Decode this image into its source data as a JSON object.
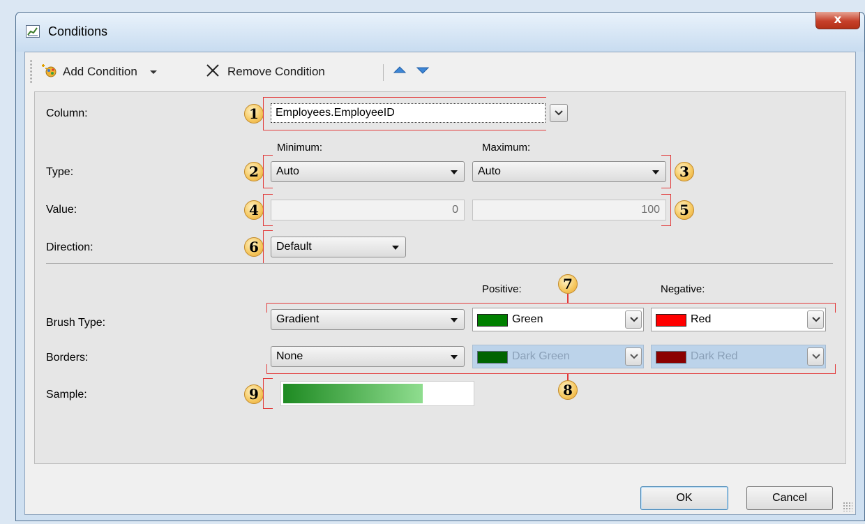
{
  "window": {
    "title": "Conditions",
    "close_label": "x"
  },
  "toolbar": {
    "add_label": "Add Condition",
    "remove_label": "Remove Condition"
  },
  "form": {
    "column_label": "Column:",
    "column_value": "Employees.EmployeeID",
    "minimum_label": "Minimum:",
    "maximum_label": "Maximum:",
    "type_label": "Type:",
    "type_min": "Auto",
    "type_max": "Auto",
    "value_label": "Value:",
    "value_min": "0",
    "value_max": "100",
    "direction_label": "Direction:",
    "direction_value": "Default",
    "positive_label": "Positive:",
    "negative_label": "Negative:",
    "brush_label": "Brush Type:",
    "brush_value": "Gradient",
    "brush_positive": "Green",
    "brush_negative": "Red",
    "borders_label": "Borders:",
    "borders_value": "None",
    "border_positive": "Dark Green",
    "border_negative": "Dark Red",
    "sample_label": "Sample:",
    "sample_fill_fraction": 0.75
  },
  "colors": {
    "green": "#008000",
    "red": "#ff0000",
    "dark_green": "#006400",
    "dark_red": "#8b0000"
  },
  "callouts": [
    "1",
    "2",
    "3",
    "4",
    "5",
    "6",
    "7",
    "8",
    "9"
  ],
  "buttons": {
    "ok": "OK",
    "cancel": "Cancel"
  }
}
